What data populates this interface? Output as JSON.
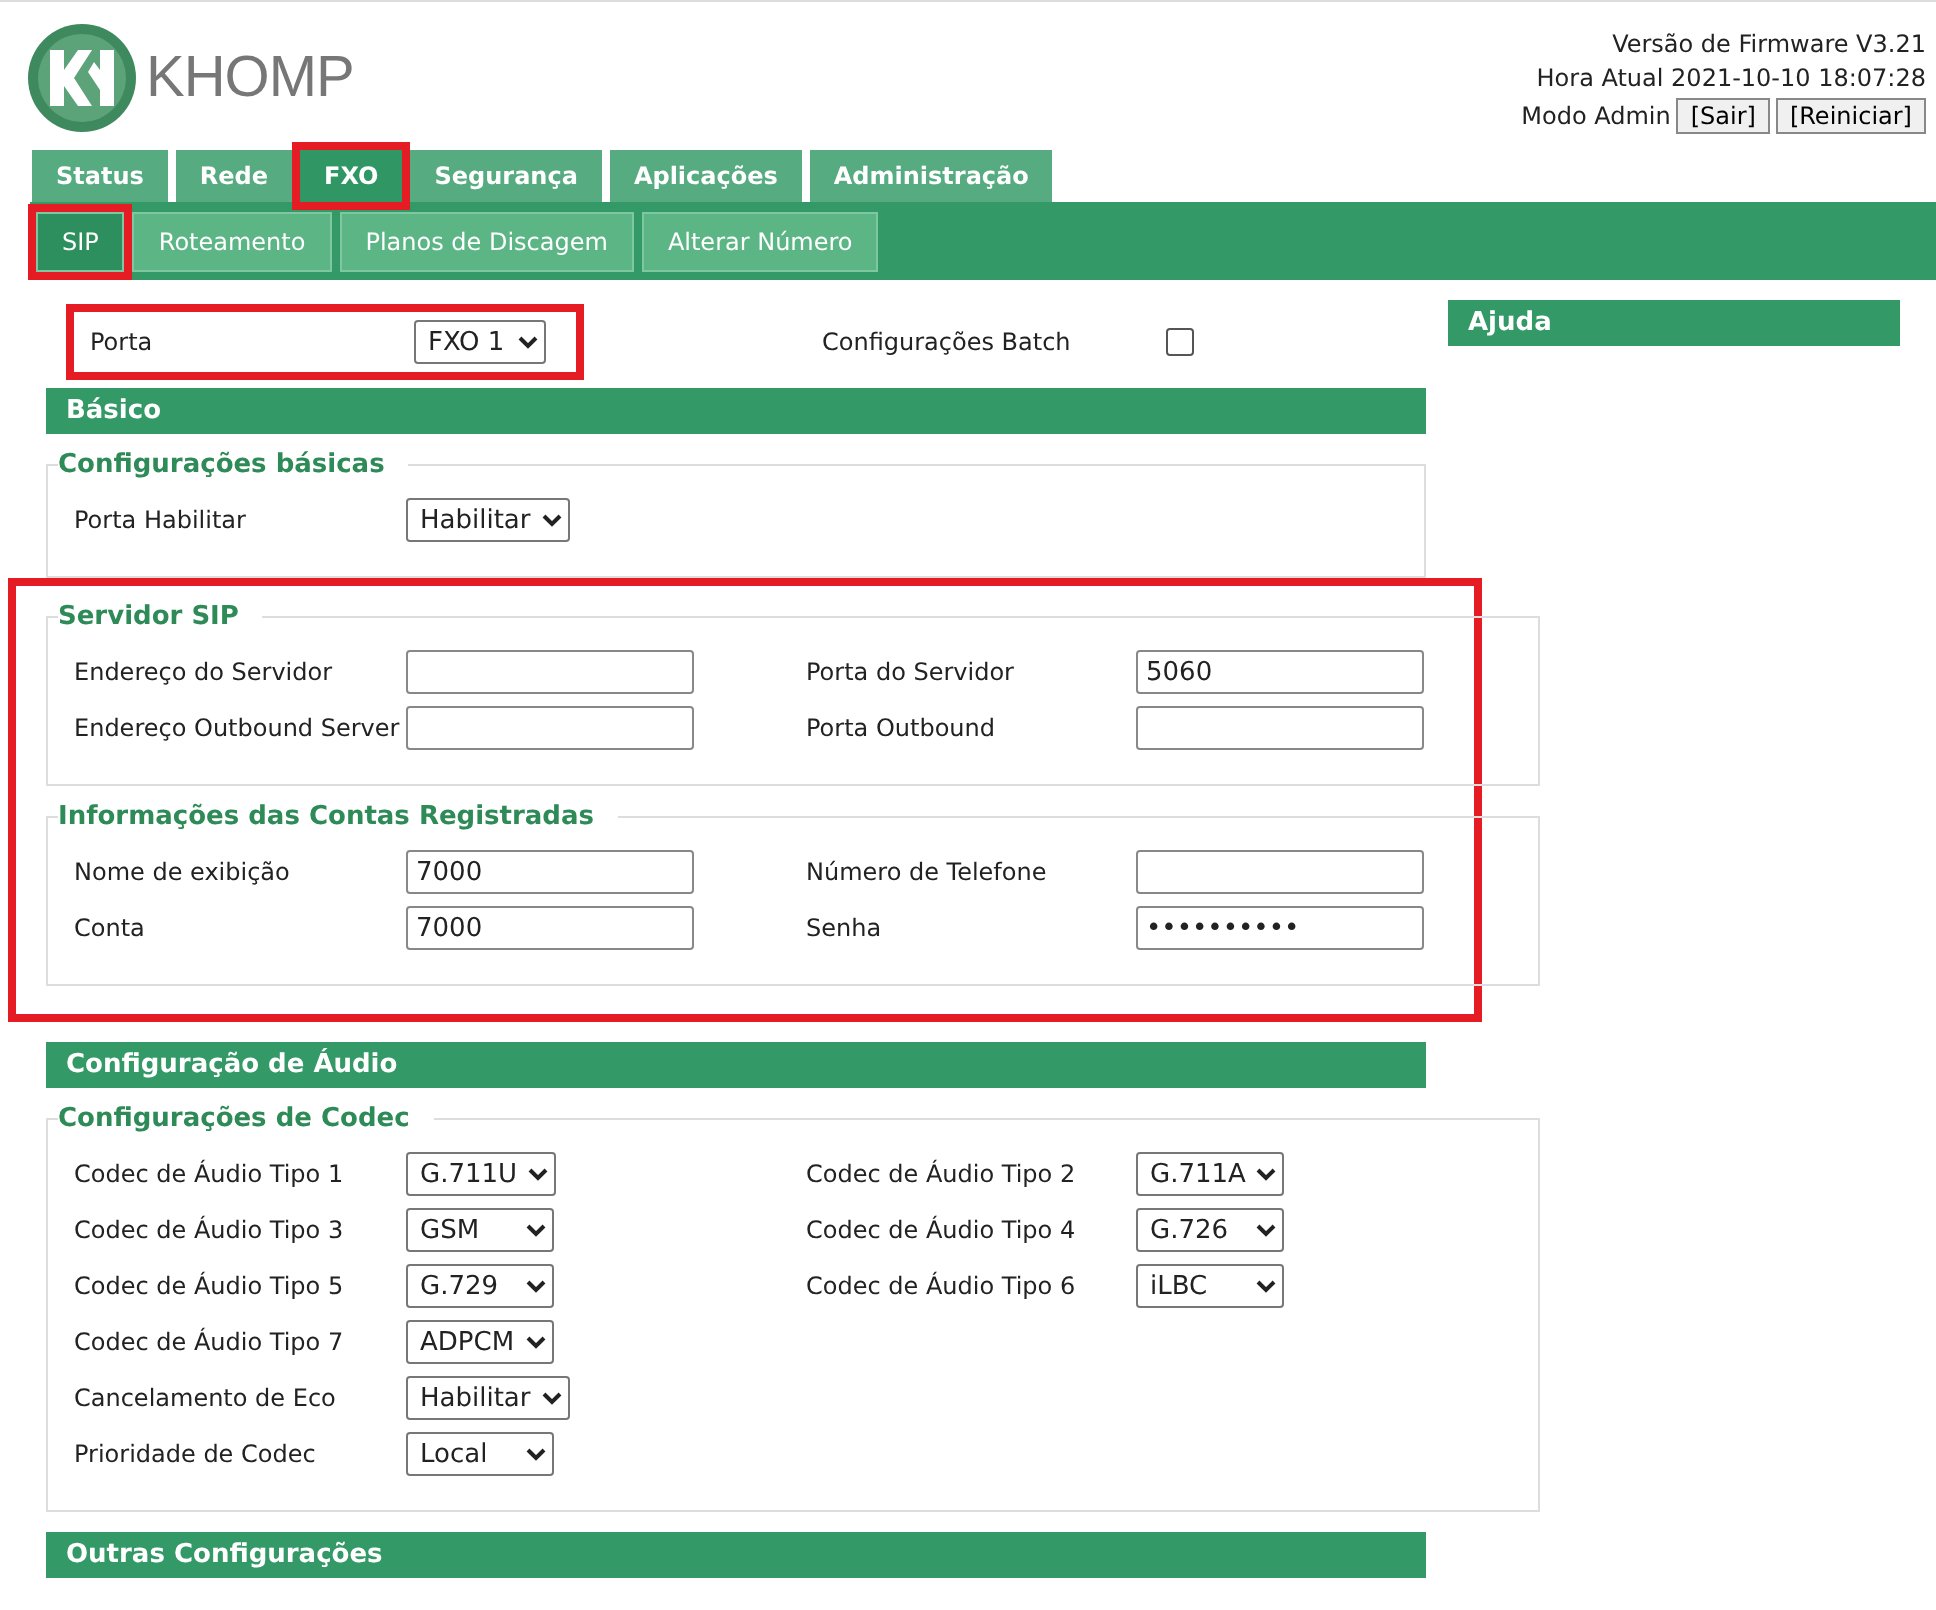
{
  "header": {
    "logo_text": "KHOMP",
    "firmware": "Versão de Firmware V3.21",
    "time": "Hora Atual 2021-10-10 18:07:28",
    "mode": "Modo Admin",
    "buttons": [
      "[Sair]",
      "[Reiniciar]"
    ]
  },
  "tabs": [
    {
      "label": "Status",
      "selected": false,
      "highlighted": false
    },
    {
      "label": "Rede",
      "selected": false,
      "highlighted": false
    },
    {
      "label": "FXO",
      "selected": true,
      "highlighted": true
    },
    {
      "label": "Segurança",
      "selected": false,
      "highlighted": false
    },
    {
      "label": "Aplicações",
      "selected": false,
      "highlighted": false
    },
    {
      "label": "Administração",
      "selected": false,
      "highlighted": false
    }
  ],
  "subtabs": [
    {
      "label": "SIP",
      "selected": true,
      "highlighted": true
    },
    {
      "label": "Roteamento",
      "selected": false,
      "highlighted": false
    },
    {
      "label": "Planos de Discagem",
      "selected": false,
      "highlighted": false
    },
    {
      "label": "Alterar Número",
      "selected": false,
      "highlighted": false
    }
  ],
  "port_row": {
    "highlighted": true,
    "label": "Porta",
    "value": "FXO 1",
    "batch_label": "Configurações Batch",
    "batch_checked": false
  },
  "sections": [
    {
      "title": "Básico",
      "groups": [
        {
          "title": "Configurações básicas",
          "highlighted": false,
          "rows": [
            [
              {
                "label": "Porta Habilitar",
                "kind": "select",
                "value": "Habilitar"
              }
            ]
          ]
        },
        {
          "title": "Servidor SIP",
          "highlighted": true,
          "rows": [
            [
              {
                "label": "Endereço do Servidor",
                "kind": "text"
              },
              {
                "label": "Porta do Servidor",
                "kind": "text",
                "value": "5060"
              }
            ],
            [
              {
                "label": "Endereço Outbound Server",
                "kind": "text"
              },
              {
                "label": "Porta Outbound",
                "kind": "text"
              }
            ]
          ]
        },
        {
          "title": "Informações das Contas Registradas",
          "highlighted": true,
          "rows": [
            [
              {
                "label": "Nome de exibição",
                "kind": "text",
                "value": "7000"
              },
              {
                "label": "Número de Telefone",
                "kind": "text"
              }
            ],
            [
              {
                "label": "Conta",
                "kind": "text",
                "value": "7000"
              },
              {
                "label": "Senha",
                "kind": "text",
                "value": "••••••••••"
              }
            ]
          ]
        }
      ]
    },
    {
      "title": "Configuração de Áudio",
      "groups": [
        {
          "title": "Configurações de Codec",
          "highlighted": false,
          "rows": [
            [
              {
                "label": "Codec de Áudio Tipo 1",
                "kind": "select",
                "value": "G.711U"
              },
              {
                "label": "Codec de Áudio Tipo 2",
                "kind": "select",
                "value": "G.711A"
              }
            ],
            [
              {
                "label": "Codec de Áudio Tipo 3",
                "kind": "select",
                "value": "GSM"
              },
              {
                "label": "Codec de Áudio Tipo 4",
                "kind": "select",
                "value": "G.726"
              }
            ],
            [
              {
                "label": "Codec de Áudio Tipo 5",
                "kind": "select",
                "value": "G.729"
              },
              {
                "label": "Codec de Áudio Tipo 6",
                "kind": "select",
                "value": "iLBC"
              }
            ],
            [
              {
                "label": "Codec de Áudio Tipo 7",
                "kind": "select",
                "value": "ADPCM"
              }
            ],
            [
              {
                "label": "Cancelamento de Eco",
                "kind": "select",
                "value": "Habilitar"
              }
            ],
            [
              {
                "label": "Prioridade de Codec",
                "kind": "select",
                "value": "Local"
              }
            ]
          ]
        }
      ]
    },
    {
      "title": "Outras Configurações"
    }
  ],
  "help": {
    "title": "Ajuda"
  }
}
